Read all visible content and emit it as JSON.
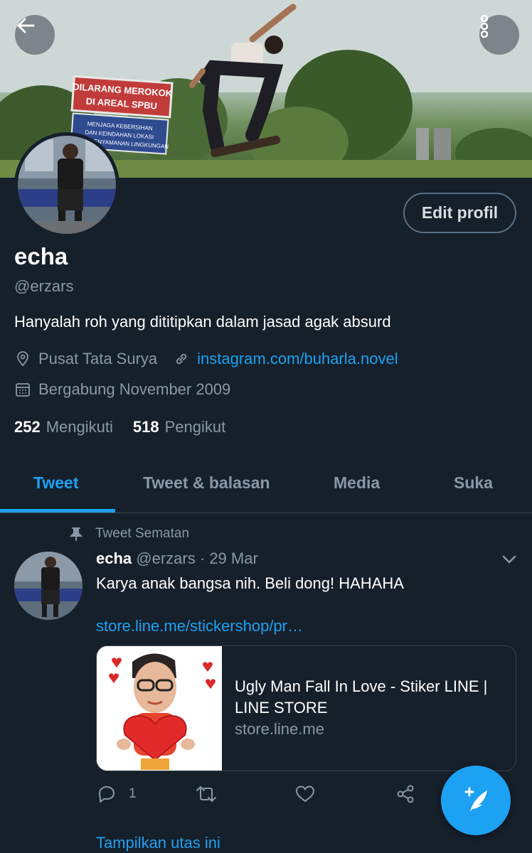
{
  "header": {
    "back_icon": "arrow-left-icon",
    "more_icon": "more-vertical-icon",
    "edit_button": "Edit profil"
  },
  "banner": {
    "sign_line1": "DILARANG MEROKOK",
    "sign_line2": "DI AREAL SPBU",
    "sign2_line1": "MENJAGA KEBERSIHAN",
    "sign2_line2": "DAN KEINDAHAN LOKASI",
    "sign2_line3": "UNTUK KENYAMANAN LINGKUNGAN"
  },
  "profile": {
    "name": "echa",
    "handle": "@erzars",
    "bio": "Hanyalah roh yang dititipkan dalam jasad agak absurd",
    "location": "Pusat Tata Surya",
    "website": "instagram.com/buharla.novel",
    "joined": "Bergabung November 2009",
    "following_count": "252",
    "following_label": "Mengikuti",
    "followers_count": "518",
    "followers_label": "Pengikut"
  },
  "tabs": [
    {
      "label": "Tweet"
    },
    {
      "label": "Tweet & balasan"
    },
    {
      "label": "Media"
    },
    {
      "label": "Suka"
    }
  ],
  "tweet": {
    "pinned_label": "Tweet Sematan",
    "author_name": "echa",
    "author_handle": "@erzars",
    "date": "· 29 Mar",
    "text": "Karya anak bangsa nih. Beli dong! HAHAHA",
    "link": "store.line.me/stickershop/pr…",
    "card": {
      "title": "Ugly Man Fall In Love - Stiker LINE | LINE STORE",
      "domain": "store.line.me"
    },
    "reply_count": "1",
    "show_thread": "Tampilkan utas ini"
  },
  "colors": {
    "background": "#15202b",
    "accent": "#1da1f2",
    "muted": "#8899a6",
    "border": "#38444d"
  }
}
